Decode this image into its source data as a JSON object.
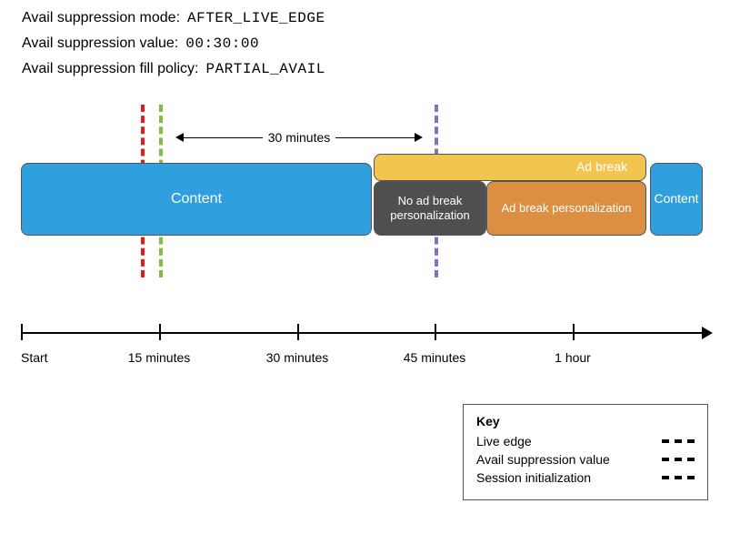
{
  "settings": {
    "mode_label": "Avail suppression mode:",
    "mode_value": "AFTER_LIVE_EDGE",
    "value_label": "Avail suppression value:",
    "value_value": "00:30:00",
    "fill_label": "Avail suppression fill policy:",
    "fill_value": "PARTIAL_AVAIL"
  },
  "range_label": "30 minutes",
  "blocks": {
    "content1": "Content",
    "adbreak": "Ad break",
    "no_ad": "No ad break personalization",
    "ad_pers": "Ad break personalization",
    "content2": "Content"
  },
  "axis": {
    "start": "Start",
    "t15": "15 minutes",
    "t30": "30 minutes",
    "t45": "45 minutes",
    "t60": "1 hour"
  },
  "key": {
    "title": "Key",
    "live_edge": "Live edge",
    "avail": "Avail suppression value",
    "session": "Session initialization"
  },
  "colors": {
    "content": "#2f9fde",
    "adbreak": "#f2c54e",
    "no_ad": "#4f4f4f",
    "ad_pers": "#dc8f43",
    "live_edge": "#7fbf3f",
    "avail": "#8a6fbf",
    "session": "#e41a1c"
  },
  "chart_data": {
    "type": "table",
    "title": "Avail suppression timeline with PARTIAL_AVAIL fill policy",
    "axis_ticks_minutes": [
      0,
      15,
      30,
      45,
      60
    ],
    "markers": [
      {
        "name": "Session initialization",
        "approx_minute": 13
      },
      {
        "name": "Live edge",
        "minute": 15
      },
      {
        "name": "Avail suppression value boundary",
        "minute": 45
      }
    ],
    "suppression_window_minutes": 30,
    "segments": [
      {
        "label": "Content",
        "start_min": 0,
        "end_min": 37
      },
      {
        "label": "Ad break",
        "start_min": 37,
        "end_min": 66,
        "sub": [
          {
            "label": "No ad break personalization",
            "start_min": 37,
            "end_min": 45
          },
          {
            "label": "Ad break personalization",
            "start_min": 45,
            "end_min": 66
          }
        ]
      },
      {
        "label": "Content",
        "start_min": 66,
        "end_min": 72
      }
    ]
  }
}
